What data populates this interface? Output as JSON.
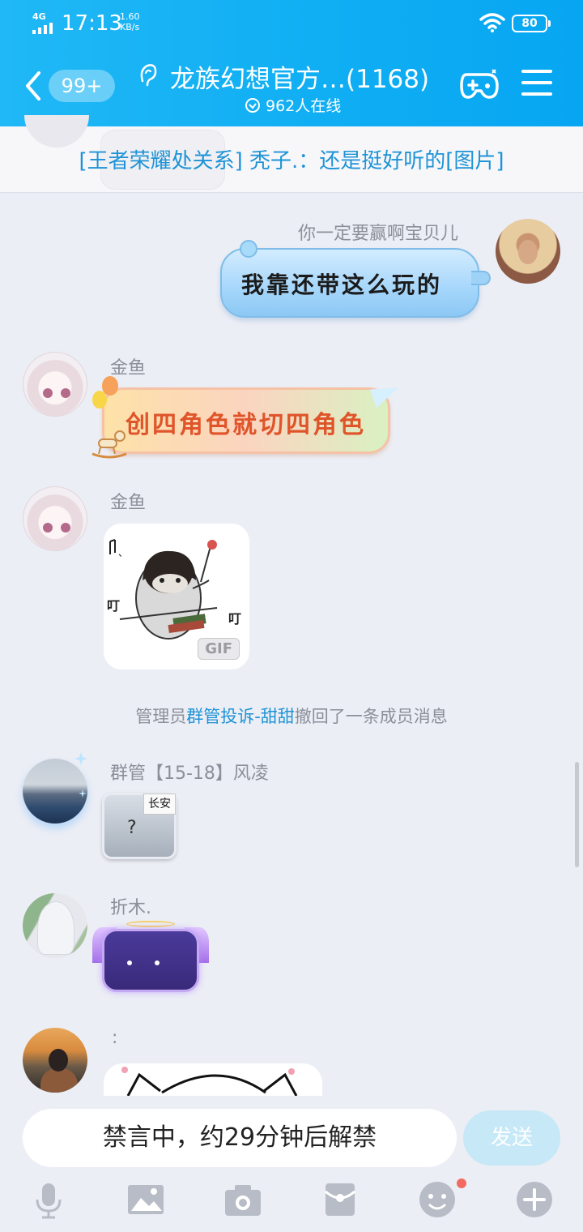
{
  "status_bar": {
    "network": "4G",
    "time": "17:13",
    "speed_value": "1.60",
    "speed_unit": "KB/s",
    "battery": "80"
  },
  "header": {
    "unread_badge": "99+",
    "title": "龙族幻想官方…(1168)",
    "online": "962人在线"
  },
  "pinned": {
    "text": "[王者荣耀处关系] 秃子.：还是挺好听的[图片]"
  },
  "messages": [
    {
      "sender": "你一定要赢啊宝贝儿",
      "type": "text-bubble",
      "text": "我靠还带这么玩的"
    },
    {
      "sender": "金鱼",
      "type": "text-bubble",
      "text": "创四角色就切四角色"
    },
    {
      "sender": "金鱼",
      "type": "sticker",
      "sticker_words": [
        "叮",
        "叮"
      ],
      "tag": "GIF"
    },
    {
      "sender": "群管【15-18】风凌",
      "type": "sticker",
      "tag": "长安",
      "symbol": "?"
    },
    {
      "sender": "折木.",
      "type": "sticker"
    },
    {
      "sender": ":",
      "type": "sticker"
    }
  ],
  "recall_notice": {
    "prefix": "管理员",
    "admin": "群管投诉-甜甜",
    "suffix": "撤回了一条成员消息"
  },
  "input": {
    "muted_text": "禁言中，约29分钟后解禁",
    "send_label": "发送"
  },
  "toolbar": [
    "microphone-icon",
    "image-icon",
    "camera-icon",
    "red-packet-icon",
    "emoji-icon",
    "plus-icon"
  ],
  "colors": {
    "header": "#10aef3",
    "link": "#1e93d6",
    "background": "#eceef5",
    "send_disabled": "#c6e8f7"
  }
}
